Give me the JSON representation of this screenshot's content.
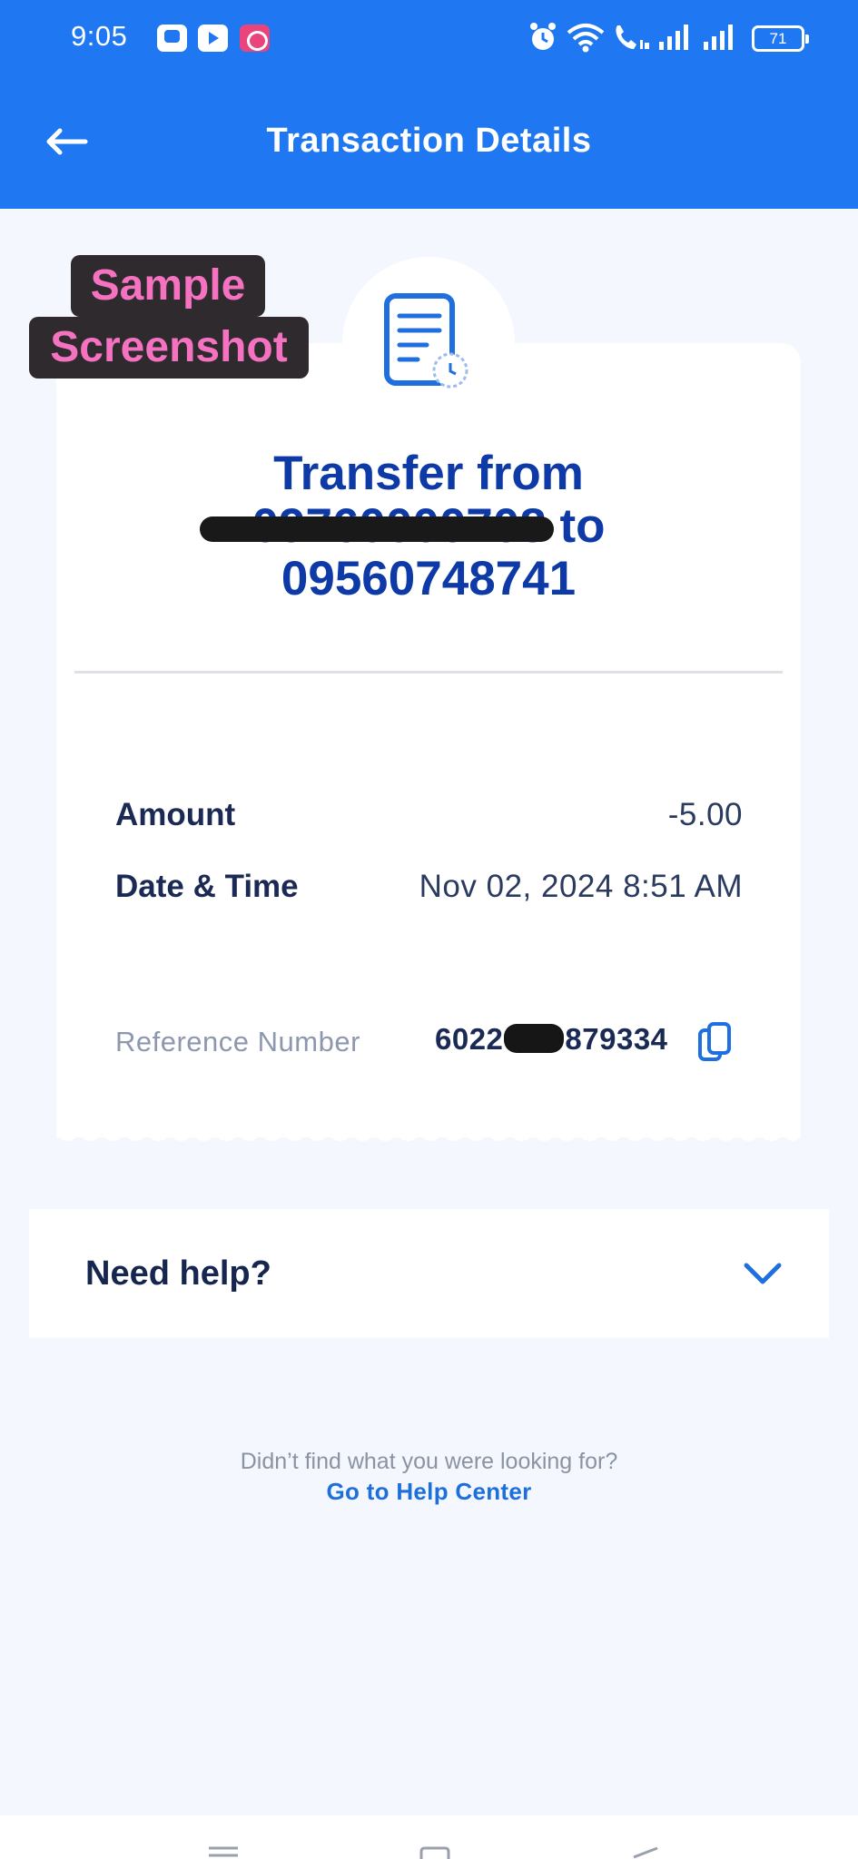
{
  "status_bar": {
    "time": "9:05",
    "apps": [
      "viber-icon",
      "youtube-icon",
      "game-icon"
    ],
    "battery": "71"
  },
  "header": {
    "title": "Transaction Details",
    "back_icon": "back-arrow-icon"
  },
  "receipt": {
    "icon": "receipt-clock-icon",
    "title_line1": "Transfer from",
    "from_number_masked": "09760000708",
    "title_to": " to",
    "to_number": "09560748741",
    "amount_label": "Amount",
    "amount_value": "-5.00",
    "datetime_label": "Date & Time",
    "datetime_value": "Nov 02, 2024 8:51 AM",
    "reference_label": "Reference Number",
    "reference_prefix": "6022",
    "reference_suffix": "879334",
    "copy_icon": "copy-icon"
  },
  "help": {
    "label": "Need help?",
    "expand_icon": "chevron-down-icon",
    "prompt": "Didn’t find what you were looking for?",
    "link": "Go to Help Center"
  },
  "watermark": {
    "line1": "Sample",
    "line2": "Screenshot"
  },
  "colors": {
    "brand_blue": "#1f78f2",
    "title_blue": "#0d3aa6",
    "watermark_pink": "#f472c0"
  }
}
